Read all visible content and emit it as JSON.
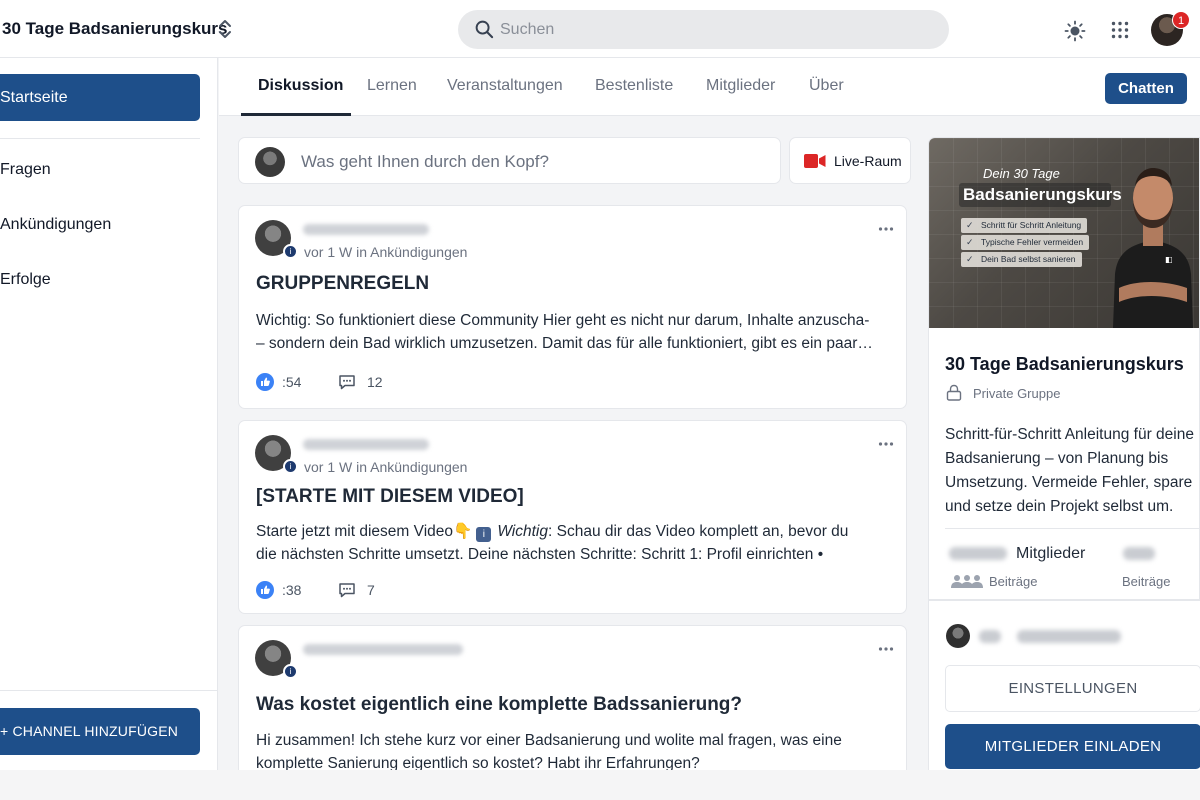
{
  "header": {
    "group_name": "30 Tage Badsanierungskurs",
    "search_placeholder": "Suchen",
    "notification_count": "1"
  },
  "sidebar": {
    "home": "Startseite",
    "items": [
      "Fragen",
      "Ankündigungen",
      "Erfolge"
    ],
    "add_channel": "+ CHANNEL HINZUFÜGEN"
  },
  "tabs": {
    "items": [
      "Diskussion",
      "Lernen",
      "Veranstaltungen",
      "Bestenliste",
      "Mitglieder",
      "Über"
    ],
    "active": "Diskussion",
    "chat_button": "Chatten"
  },
  "composer": {
    "placeholder": "Was geht Ihnen durch den Kopf?",
    "live_room": "Live-Raum"
  },
  "posts": [
    {
      "meta": "vor 1 W in Ankündigungen",
      "title": "GRUPPENREGELN",
      "body_lines": [
        "Wichtig: So funktioniert diese Community Hier geht es nicht nur darum, Inhalte anzuscha-",
        "– sondern dein Bad wirklich umzusetzen. Damit das für alle funktioniert, gibt es ein paar…"
      ],
      "likes": ":54",
      "comments": "12"
    },
    {
      "meta": "vor 1 W in Ankündigungen",
      "title": "[STARTE MIT DIESEM VIDEO]",
      "body_line1_a": "Starte jetzt mit diesem Video",
      "body_line1_emoji": "👇",
      "body_line1_b_label": "Wichtig",
      "body_line1_c": ": Schau dir das Video komplett an, bevor du",
      "body_line2": "die nächsten Schritte umsetzt. Deine nächsten Schritte: Schritt 1: Profil einrichten •",
      "likes": ":38",
      "comments": "7"
    },
    {
      "title": "Was kostet eigentlich eine komplette Badssanierung?",
      "body_lines": [
        "Hi zusammen! Ich stehe kurz vor einer Badsanierung und wolite mal fragen, was eine",
        "komplette Sanierung eigentlich so kostet? Habt ihr Erfahrungen?"
      ]
    }
  ],
  "group_card": {
    "cover_subtitle": "Dein 30 Tage",
    "cover_title": "Badsanierungskurs",
    "cover_checks": [
      "Schritt für Schritt Anleitung",
      "Typische Fehler vermeiden",
      "Dein Bad selbst sanieren"
    ],
    "title": "30 Tage Badsanierungskurs",
    "privacy": "Private Gruppe",
    "description_lines": [
      "Schritt-für-Schritt Anleitung für deine",
      "Badsanierung – von Planung bis",
      "Umsetzung. Vermeide Fehler, spare",
      "und setze dein Projekt selbst um."
    ],
    "members_label": "Mitglieder",
    "posts_label_1": "Beiträge",
    "posts_label_2": "Beiträge",
    "settings_button": "EINSTELLUNGEN",
    "invite_button": "MITGLIEDER EINLADEN"
  },
  "colors": {
    "accent": "#1e4f8a",
    "badge": "#dc2626",
    "like": "#3b82f6",
    "live": "#dc2626"
  },
  "icons": [
    "switcher-icon",
    "search-icon",
    "theme-sun-icon",
    "apps-grid-icon",
    "video-camera-icon",
    "like-icon",
    "comment-icon",
    "more-icon",
    "lock-icon",
    "people-icon"
  ]
}
